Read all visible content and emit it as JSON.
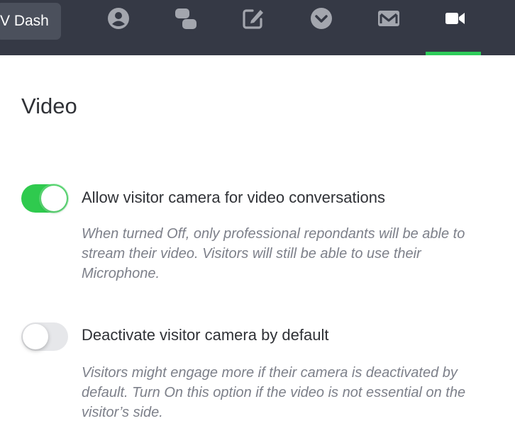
{
  "topbar": {
    "dash_label": "V Dash",
    "tabs": [
      {
        "icon": "user-circle-icon"
      },
      {
        "icon": "chat-bubbles-icon"
      },
      {
        "icon": "edit-icon"
      },
      {
        "icon": "chevron-circle-down-icon"
      },
      {
        "icon": "mail-icon"
      },
      {
        "icon": "video-camera-icon",
        "active": true
      }
    ],
    "accent_color": "#2ecc5a",
    "background_color": "#353945"
  },
  "page": {
    "title": "Video"
  },
  "settings": [
    {
      "title": "Allow visitor camera for video conversations",
      "description": "When turned Off, only professional repondants will be able to stream their video. Visitors will still be able to use their Microphone.",
      "enabled": true
    },
    {
      "title": "Deactivate visitor camera by default",
      "description": "Visitors might engage more if their camera is deactivated by default. Turn On this option if the video is not essential on the visitor’s side.",
      "enabled": false
    }
  ]
}
